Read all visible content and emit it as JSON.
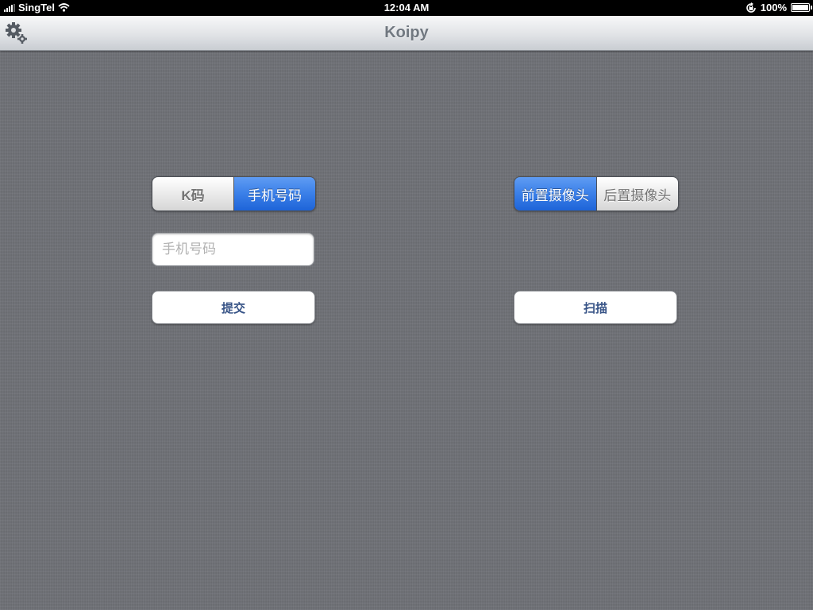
{
  "status_bar": {
    "carrier": "SingTel",
    "time": "12:04 AM",
    "battery": "100%"
  },
  "nav": {
    "title": "Koipy",
    "left_icon": "gear-icon"
  },
  "code_type_segment": {
    "options": [
      "K码",
      "手机号码"
    ],
    "selected_index": 1
  },
  "phone_field": {
    "value": "",
    "placeholder": "手机号码"
  },
  "submit_button": {
    "label": "提交"
  },
  "camera_segment": {
    "options": [
      "前置摄像头",
      "后置摄像头"
    ],
    "selected_index": 0
  },
  "scan_button": {
    "label": "扫描"
  },
  "colors": {
    "selected_segment": "#3a7fe8",
    "button_text": "#385487",
    "background": "#6d6f75"
  }
}
